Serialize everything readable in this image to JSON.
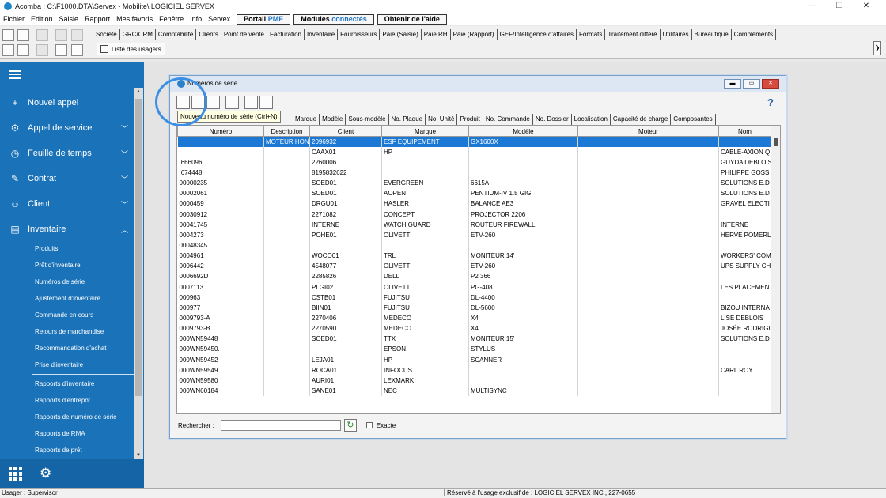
{
  "window": {
    "title": "Acomba : C:\\F1000.DTA\\Servex - Mobilite\\  LOGICIEL SERVEX",
    "controls": [
      "—",
      "❐",
      "✕"
    ]
  },
  "menu": {
    "items": [
      "Fichier",
      "Edition",
      "Saisie",
      "Rapport",
      "Mes favoris",
      "Fenêtre",
      "Info",
      "Servex"
    ],
    "portail_a": "Portail ",
    "portail_b": "PME",
    "modules_a": "Modules ",
    "modules_b": "connectés",
    "aide": "Obtenir de l'aide"
  },
  "modules": [
    "Société",
    "GRC/CRM",
    "Comptabilité",
    "Clients",
    "Point de vente",
    "Facturation",
    "Inventaire",
    "Fournisseurs",
    "Paie (Saisie)",
    "Paie RH",
    "Paie (Rapport)",
    "GEF/Intelligence d'affaires",
    "Formats",
    "Traitement différé",
    "Utilitaires",
    "Bureautique",
    "Compléments"
  ],
  "users_list_label": "Liste des usagers",
  "sidebar": {
    "main": [
      {
        "label": "Nouvel appel",
        "icon": "+",
        "chevron": ""
      },
      {
        "label": "Appel de service",
        "icon": "⚙",
        "chevron": "﹀"
      },
      {
        "label": "Feuille de temps",
        "icon": "◷",
        "chevron": "﹀"
      },
      {
        "label": "Contrat",
        "icon": "✎",
        "chevron": "﹀"
      },
      {
        "label": "Client",
        "icon": "☺",
        "chevron": "﹀"
      },
      {
        "label": "Inventaire",
        "icon": "▤",
        "chevron": "︿"
      }
    ],
    "sub": [
      "Produits",
      "Prêt d'inventaire",
      "Numéros de série",
      "Ajustement d'inventaire",
      "Commande en cours",
      "Retours de marchandise",
      "Recommandation d'achat",
      "Prise d'inventaire",
      "Rapports d'inventaire",
      "Rapports d'entrepôt",
      "Rapports de numéro de série",
      "Rapports de RMA",
      "Rapports de prêt"
    ]
  },
  "dialog": {
    "title": "Numéros de série",
    "help": "?",
    "tooltip": "Nouveau numéro de série (Ctrl+N)",
    "filter_tabs": [
      "Marque",
      "Modèle",
      "Sous-modèle",
      "No. Plaque",
      "No. Unité",
      "Produit",
      "No. Commande",
      "No. Dossier",
      "Localisation",
      "Capacité de charge",
      "Composantes"
    ],
    "columns": [
      "Numéro",
      "Description",
      "Client",
      "Marque",
      "Modèle",
      "Moteur",
      "Nom"
    ],
    "rows": [
      [
        "",
        "MOTEUR HONDA",
        "2096932",
        "ESF EQUIPEMENT",
        "GX1600X",
        "",
        ""
      ],
      [
        ".",
        "",
        "CAAX01",
        "HP",
        "",
        "",
        "CABLE-AXION Q"
      ],
      [
        ".666096",
        "",
        "2260006",
        "",
        "",
        "",
        "GUYDA DEBLOIS"
      ],
      [
        ".674448",
        "",
        "8195832622",
        "",
        "",
        "",
        "PHILIPPE GOSS"
      ],
      [
        "00000235",
        "",
        "SOED01",
        "EVERGREEN",
        "6615A",
        "",
        "SOLUTIONS E.D"
      ],
      [
        "00002061",
        "",
        "SOED01",
        "AOPEN",
        "PENTIUM-IV 1.5 GIG",
        "",
        "SOLUTIONS E.D"
      ],
      [
        "0000459",
        "",
        "DRGU01",
        "HASLER",
        "BALANCE AE3",
        "",
        "GRAVEL ELECTI"
      ],
      [
        "00030912",
        "",
        "2271082",
        "CONCEPT",
        "PROJECTOR 2206",
        "",
        ""
      ],
      [
        "00041745",
        "",
        "INTERNE",
        "WATCH GUARD",
        "ROUTEUR FIREWALL",
        "",
        "INTERNE"
      ],
      [
        "0004273",
        "",
        "POHE01",
        "OLIVETTI",
        "ETV-260",
        "",
        "HERVE POMERL"
      ],
      [
        "00048345",
        "",
        "",
        "",
        "",
        "",
        ""
      ],
      [
        "0004961",
        "",
        "WOCO01",
        "TRL",
        "MONITEUR 14'",
        "",
        "WORKERS' COM"
      ],
      [
        "0006442",
        "",
        "4548077",
        "OLIVETTI",
        "ETV-260",
        "",
        "UPS SUPPLY CH"
      ],
      [
        "0006692D",
        "",
        "2285826",
        "DELL",
        "P2 366",
        "",
        ""
      ],
      [
        "0007113",
        "",
        "PLGI02",
        "OLIVETTI",
        "PG-408",
        "",
        "LES PLACEMEN"
      ],
      [
        "000963",
        "",
        "CSTB01",
        "FUJITSU",
        "DL-4400",
        "",
        ""
      ],
      [
        "000977",
        "",
        "BIIN01",
        "FUJITSU",
        "DL-5600",
        "",
        "BIZOU INTERNA"
      ],
      [
        "0009793-A",
        "",
        "2270406",
        "MEDECO",
        "X4",
        "",
        "LISE DEBLOIS"
      ],
      [
        "0009793-B",
        "",
        "2270590",
        "MEDECO",
        "X4",
        "",
        "JOSÉE RODRIGU"
      ],
      [
        "000WN59448",
        "",
        "SOED01",
        "TTX",
        "MONITEUR 15'",
        "",
        "SOLUTIONS E.D"
      ],
      [
        "000WN59450.",
        "",
        "",
        "EPSON",
        "STYLUS",
        "",
        ""
      ],
      [
        "000WN59452",
        "",
        "LEJA01",
        "HP",
        "SCANNER",
        "",
        ""
      ],
      [
        "000WN59549",
        "",
        "ROCA01",
        "INFOCUS",
        "",
        "",
        "CARL ROY"
      ],
      [
        "000WN59580",
        "",
        "AURI01",
        "LEXMARK",
        "",
        "",
        ""
      ],
      [
        "000WN60184",
        "",
        "SANE01",
        "NEC",
        "MULTISYNC",
        "",
        ""
      ]
    ],
    "search_label": "Rechercher :",
    "search_value": "",
    "exact_label": "Exacte"
  },
  "status": {
    "user": "Usager : Supervisor",
    "owner": "Réservé à l'usage exclusif de : LOGICIEL SERVEX INC., 227-0655"
  },
  "colors": {
    "sidebar": "#1a72b8",
    "selection": "#1b78d4",
    "highlight": "#3b8ee6"
  }
}
